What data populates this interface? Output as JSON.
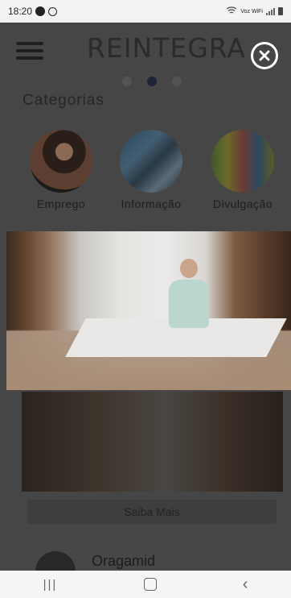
{
  "status": {
    "time": "18:20",
    "carrier": "Voz WiFi"
  },
  "app": {
    "logo": "REINTEGRA"
  },
  "carousel": {
    "pages": 3,
    "active": 1
  },
  "categories": {
    "title": "Categorias",
    "items": [
      {
        "label": "Emprego"
      },
      {
        "label": "Informação"
      },
      {
        "label": "Divulgação"
      }
    ]
  },
  "post": {
    "button": "Saiba Mais"
  },
  "next_post": {
    "author": "Oragamid"
  }
}
